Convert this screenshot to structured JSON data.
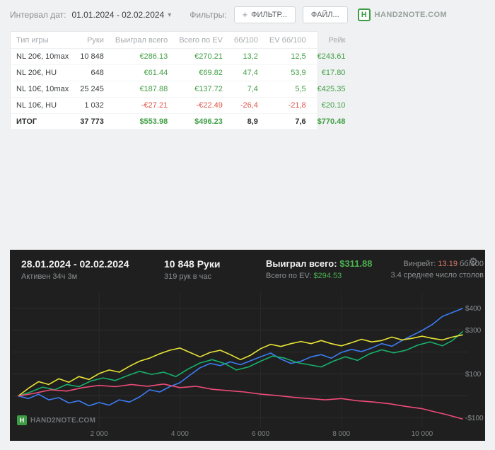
{
  "colors": {
    "green": "#43a047",
    "red": "#e05349",
    "panel_green": "#4caf50",
    "winrate_red": "#d9776b",
    "brand_green": "#3f9c46"
  },
  "icons": {
    "chevron_down": "▾",
    "plus": "+",
    "gear": "⚙",
    "logo_letter": "H"
  },
  "toolbar": {
    "date_label": "Интервал дат:",
    "date_range": "01.01.2024 - 02.02.2024",
    "filters_label": "Фильтры:",
    "filter_button": "ФИЛЬТР...",
    "file_button": "ФАЙЛ...",
    "logo_text": "HAND2NOTE.COM"
  },
  "table": {
    "columns": [
      "Тип игры",
      "Руки",
      "Выиграл всего",
      "Всего по EV",
      "бб/100",
      "EV бб/100",
      "Рейк"
    ],
    "rows": [
      {
        "game": "NL 20€, 10max",
        "hands": "10 848",
        "won": "€286.13",
        "ev": "€270.21",
        "bb": "13,2",
        "evbb": "12,5",
        "rake": "€243.61"
      },
      {
        "game": "NL 20€, HU",
        "hands": "648",
        "won": "€61.44",
        "ev": "€69.82",
        "bb": "47,4",
        "evbb": "53,9",
        "rake": "€17.80"
      },
      {
        "game": "NL 10€, 10max",
        "hands": "25 245",
        "won": "€187.88",
        "ev": "€137.72",
        "bb": "7,4",
        "evbb": "5,5",
        "rake": "€425.35"
      },
      {
        "game": "NL 10€, HU",
        "hands": "1 032",
        "won": "-€27.21",
        "ev": "-€22.49",
        "bb": "-26,4",
        "evbb": "-21,8",
        "rake": "€20.10"
      }
    ],
    "total": {
      "game": "ИТОГ",
      "hands": "37 773",
      "won": "$553.98",
      "ev": "$496.23",
      "bb": "8,9",
      "evbb": "7,6",
      "rake": "$770.48"
    }
  },
  "panel": {
    "date_range": "28.01.2024 - 02.02.2024",
    "active_time": "Активен 34ч 3м",
    "hands": "10 848 Руки",
    "hands_per_hour": "319 рук в час",
    "won_label": "Выиграл всего:",
    "won_value": "$311.88",
    "ev_label": "Всего по EV:",
    "ev_value": "$294.53",
    "winrate_label": "Винрейт:",
    "winrate_value": "13.19",
    "winrate_unit": "бб/100",
    "avg_tables": "3.4 среднее число столов",
    "watermark": "HAND2NOTE.COM"
  },
  "chart_data": {
    "type": "line",
    "xlabel": "",
    "ylabel": "",
    "x_range": [
      0,
      11000
    ],
    "y_range": [
      -140,
      440
    ],
    "grid_x_values": [
      2000,
      4000,
      6000,
      8000,
      10000
    ],
    "grid_y_values": [
      400,
      300,
      200,
      100,
      0,
      -100
    ],
    "x_ticks": [
      {
        "label": "2 000",
        "value": 2000
      },
      {
        "label": "4 000",
        "value": 4000
      },
      {
        "label": "6 000",
        "value": 6000
      },
      {
        "label": "8 000",
        "value": 8000
      },
      {
        "label": "10 000",
        "value": 10000
      }
    ],
    "y_ticks": [
      {
        "label": "$400",
        "value": 400
      },
      {
        "label": "$300",
        "value": 300
      },
      {
        "label": "$100",
        "value": 100
      },
      {
        "label": "-$100",
        "value": -100
      }
    ],
    "series": [
      {
        "name": "winnings-blue",
        "color": "#3b7df5",
        "points": [
          [
            0,
            0
          ],
          [
            250,
            -12
          ],
          [
            500,
            8
          ],
          [
            750,
            -18
          ],
          [
            1000,
            -8
          ],
          [
            1250,
            -32
          ],
          [
            1500,
            -22
          ],
          [
            1750,
            -45
          ],
          [
            2000,
            -30
          ],
          [
            2250,
            -42
          ],
          [
            2500,
            -18
          ],
          [
            2750,
            -28
          ],
          [
            3000,
            -5
          ],
          [
            3250,
            28
          ],
          [
            3500,
            18
          ],
          [
            3750,
            42
          ],
          [
            4000,
            60
          ],
          [
            4250,
            95
          ],
          [
            4500,
            128
          ],
          [
            4750,
            148
          ],
          [
            5000,
            138
          ],
          [
            5250,
            155
          ],
          [
            5500,
            142
          ],
          [
            5750,
            160
          ],
          [
            6000,
            178
          ],
          [
            6250,
            195
          ],
          [
            6500,
            168
          ],
          [
            6750,
            148
          ],
          [
            7000,
            158
          ],
          [
            7250,
            178
          ],
          [
            7500,
            188
          ],
          [
            7750,
            172
          ],
          [
            8000,
            198
          ],
          [
            8250,
            212
          ],
          [
            8500,
            202
          ],
          [
            8750,
            218
          ],
          [
            9000,
            238
          ],
          [
            9250,
            226
          ],
          [
            9500,
            252
          ],
          [
            9750,
            275
          ],
          [
            10000,
            298
          ],
          [
            10250,
            325
          ],
          [
            10500,
            362
          ],
          [
            10750,
            380
          ],
          [
            11000,
            398
          ]
        ]
      },
      {
        "name": "winnings-green",
        "color": "#17b06b",
        "points": [
          [
            0,
            0
          ],
          [
            300,
            18
          ],
          [
            600,
            40
          ],
          [
            900,
            28
          ],
          [
            1200,
            52
          ],
          [
            1500,
            42
          ],
          [
            1800,
            68
          ],
          [
            2100,
            82
          ],
          [
            2400,
            70
          ],
          [
            2700,
            92
          ],
          [
            3000,
            112
          ],
          [
            3300,
            98
          ],
          [
            3600,
            108
          ],
          [
            3900,
            88
          ],
          [
            4200,
            122
          ],
          [
            4500,
            150
          ],
          [
            4800,
            165
          ],
          [
            5100,
            148
          ],
          [
            5400,
            118
          ],
          [
            5700,
            132
          ],
          [
            6000,
            158
          ],
          [
            6300,
            182
          ],
          [
            6600,
            172
          ],
          [
            6900,
            152
          ],
          [
            7200,
            142
          ],
          [
            7500,
            132
          ],
          [
            7800,
            158
          ],
          [
            8100,
            178
          ],
          [
            8400,
            162
          ],
          [
            8700,
            192
          ],
          [
            9000,
            210
          ],
          [
            9300,
            196
          ],
          [
            9600,
            208
          ],
          [
            9900,
            232
          ],
          [
            10200,
            246
          ],
          [
            10500,
            228
          ],
          [
            10750,
            252
          ],
          [
            11000,
            292
          ]
        ]
      },
      {
        "name": "winnings-yellow",
        "color": "#e8e435",
        "points": [
          [
            0,
            0
          ],
          [
            250,
            35
          ],
          [
            500,
            65
          ],
          [
            750,
            52
          ],
          [
            1000,
            78
          ],
          [
            1250,
            62
          ],
          [
            1500,
            88
          ],
          [
            1750,
            75
          ],
          [
            2000,
            102
          ],
          [
            2250,
            118
          ],
          [
            2500,
            108
          ],
          [
            2750,
            135
          ],
          [
            3000,
            158
          ],
          [
            3250,
            172
          ],
          [
            3500,
            192
          ],
          [
            3750,
            208
          ],
          [
            4000,
            218
          ],
          [
            4250,
            198
          ],
          [
            4500,
            178
          ],
          [
            4750,
            198
          ],
          [
            5000,
            208
          ],
          [
            5250,
            188
          ],
          [
            5500,
            165
          ],
          [
            5750,
            185
          ],
          [
            6000,
            215
          ],
          [
            6250,
            235
          ],
          [
            6500,
            225
          ],
          [
            6750,
            238
          ],
          [
            7000,
            248
          ],
          [
            7250,
            238
          ],
          [
            7500,
            252
          ],
          [
            7750,
            238
          ],
          [
            8000,
            228
          ],
          [
            8250,
            242
          ],
          [
            8500,
            258
          ],
          [
            8750,
            246
          ],
          [
            9000,
            252
          ],
          [
            9250,
            268
          ],
          [
            9500,
            255
          ],
          [
            9750,
            262
          ],
          [
            10000,
            272
          ],
          [
            10250,
            262
          ],
          [
            10500,
            255
          ],
          [
            10750,
            268
          ],
          [
            11000,
            278
          ]
        ]
      },
      {
        "name": "winnings-pink",
        "color": "#ee4b78",
        "points": [
          [
            0,
            0
          ],
          [
            400,
            12
          ],
          [
            800,
            28
          ],
          [
            1200,
            22
          ],
          [
            1600,
            38
          ],
          [
            2000,
            48
          ],
          [
            2400,
            42
          ],
          [
            2800,
            52
          ],
          [
            3200,
            44
          ],
          [
            3600,
            54
          ],
          [
            4000,
            38
          ],
          [
            4400,
            44
          ],
          [
            4800,
            30
          ],
          [
            5200,
            24
          ],
          [
            5600,
            18
          ],
          [
            6000,
            8
          ],
          [
            6400,
            2
          ],
          [
            6800,
            -6
          ],
          [
            7200,
            -12
          ],
          [
            7600,
            -18
          ],
          [
            8000,
            -12
          ],
          [
            8400,
            -22
          ],
          [
            8800,
            -28
          ],
          [
            9200,
            -36
          ],
          [
            9600,
            -48
          ],
          [
            10000,
            -58
          ],
          [
            10300,
            -72
          ],
          [
            10600,
            -85
          ],
          [
            10800,
            -95
          ],
          [
            11000,
            -105
          ]
        ]
      }
    ]
  }
}
